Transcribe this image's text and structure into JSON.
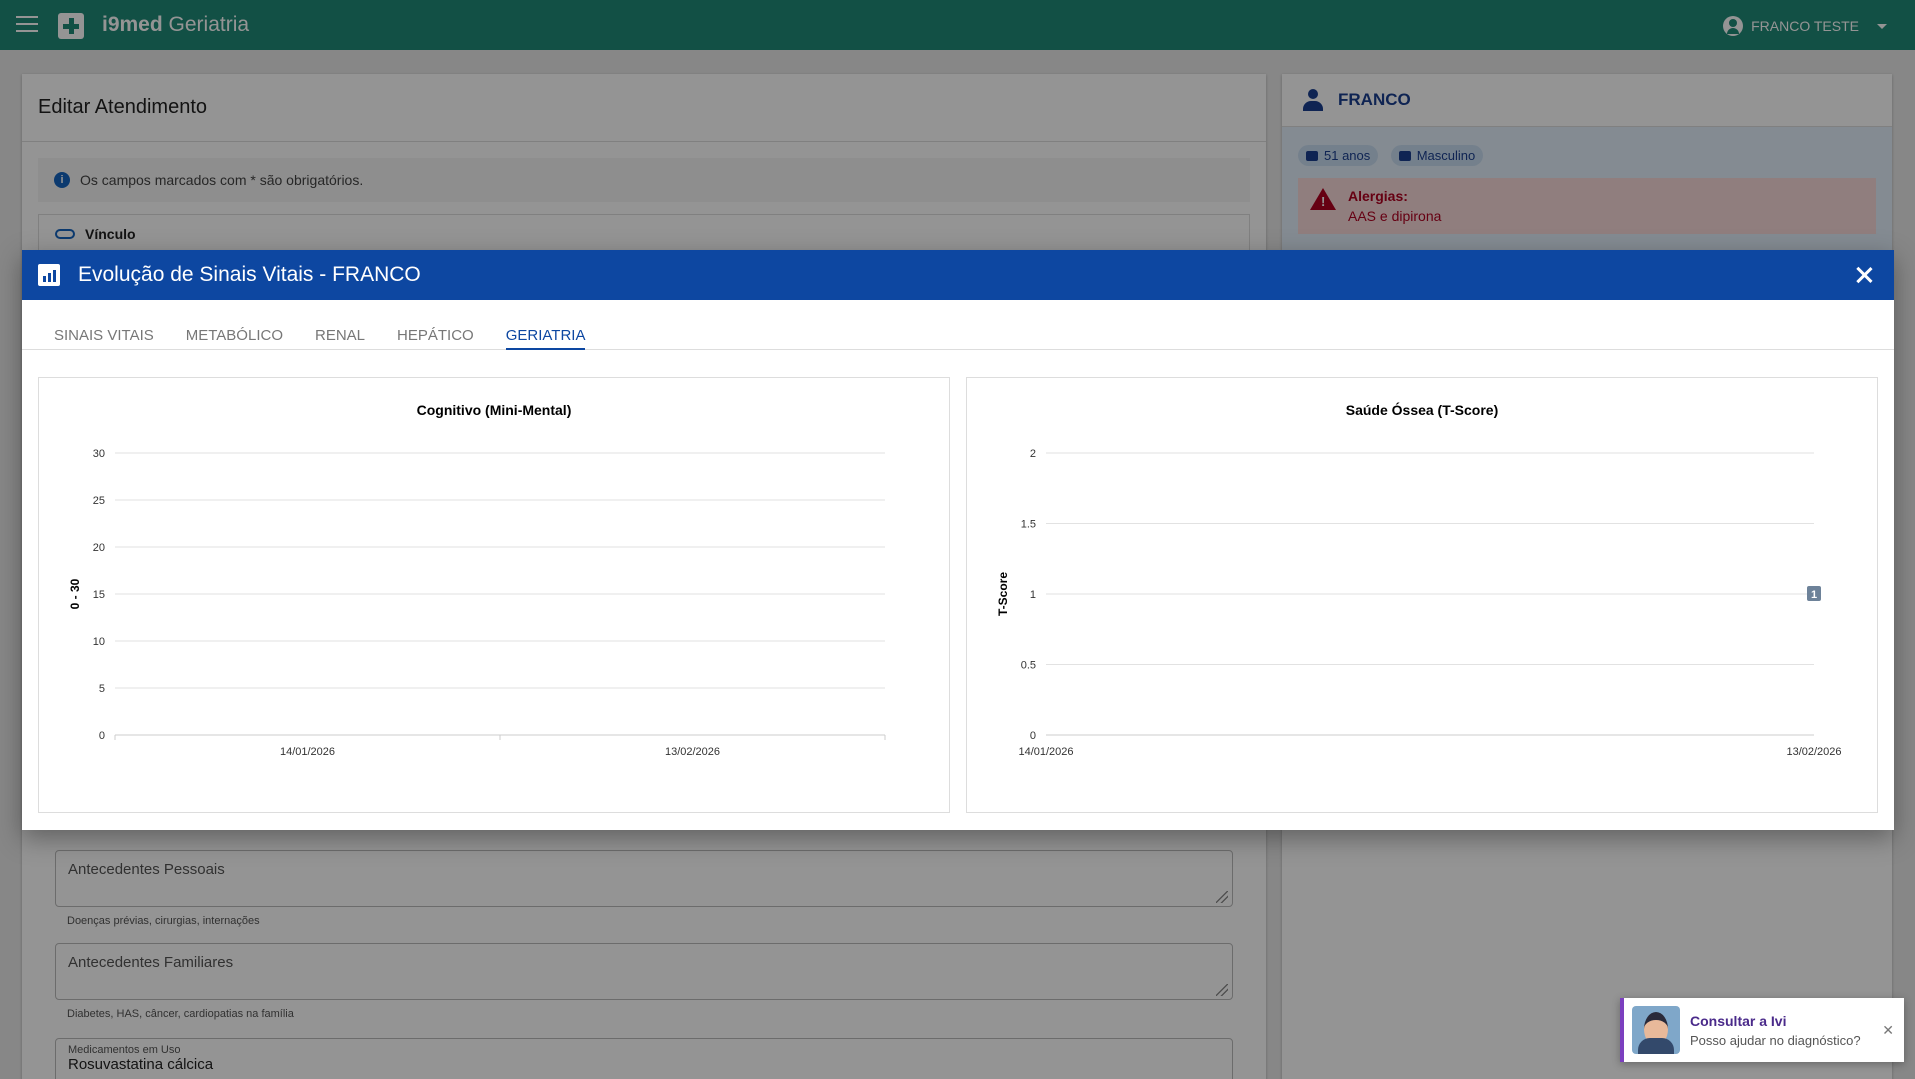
{
  "app": {
    "brand_bold": "i9med",
    "brand_rest": " Geriatria",
    "user_name": "FRANCO TESTE"
  },
  "form": {
    "title": "Editar Atendimento",
    "info": "Os campos marcados com * são obrigatórios.",
    "vinculo_label": "Vínculo",
    "antecedentes_pessoais": {
      "placeholder": "Antecedentes Pessoais",
      "helper": "Doenças prévias, cirurgias, internações"
    },
    "antecedentes_familiares": {
      "placeholder": "Antecedentes Familiares",
      "helper": "Diabetes, HAS, câncer, cardiopatias na família"
    },
    "medicamentos": {
      "label": "Medicamentos em Uso",
      "value": "Rosuvastatina cálcica"
    }
  },
  "patient": {
    "name": "FRANCO",
    "age": "51 anos",
    "sex": "Masculino",
    "allergy_title": "Alergias:",
    "allergy_text": "AAS e dipirona"
  },
  "dialog": {
    "title": "Evolução de Sinais Vitais - FRANCO",
    "tabs": [
      "SINAIS VITAIS",
      "METABÓLICO",
      "RENAL",
      "HEPÁTICO",
      "GERIATRIA"
    ],
    "active_tab": "GERIATRIA"
  },
  "chart_data": [
    {
      "type": "line",
      "title": "Cognitivo (Mini-Mental)",
      "ylabel": "0 - 30",
      "categories": [
        "14/01/2026",
        "13/02/2026"
      ],
      "ylim": [
        0,
        30
      ],
      "yticks": [
        0,
        5,
        10,
        15,
        20,
        25,
        30
      ],
      "series": [
        {
          "values": [
            null,
            null
          ]
        }
      ],
      "grid": true
    },
    {
      "type": "line",
      "title": "Saúde Óssea (T-Score)",
      "ylabel": "T-Score",
      "categories": [
        "14/01/2026",
        "13/02/2026"
      ],
      "ylim": [
        0,
        2
      ],
      "yticks": [
        0,
        0.5,
        1,
        1.5,
        2
      ],
      "series": [
        {
          "values": [
            null,
            1
          ],
          "data_labels": [
            "",
            "1"
          ]
        }
      ],
      "grid": true
    }
  ],
  "assistant": {
    "title": "Consultar a Ivi",
    "text": "Posso ajudar no diagnóstico?"
  },
  "colors": {
    "appbar": "#1f8a78",
    "dialog_header": "#0d47a1",
    "accent": "#0d47a1",
    "allergy": "#b00020",
    "assistant": "#7b3fbf"
  }
}
